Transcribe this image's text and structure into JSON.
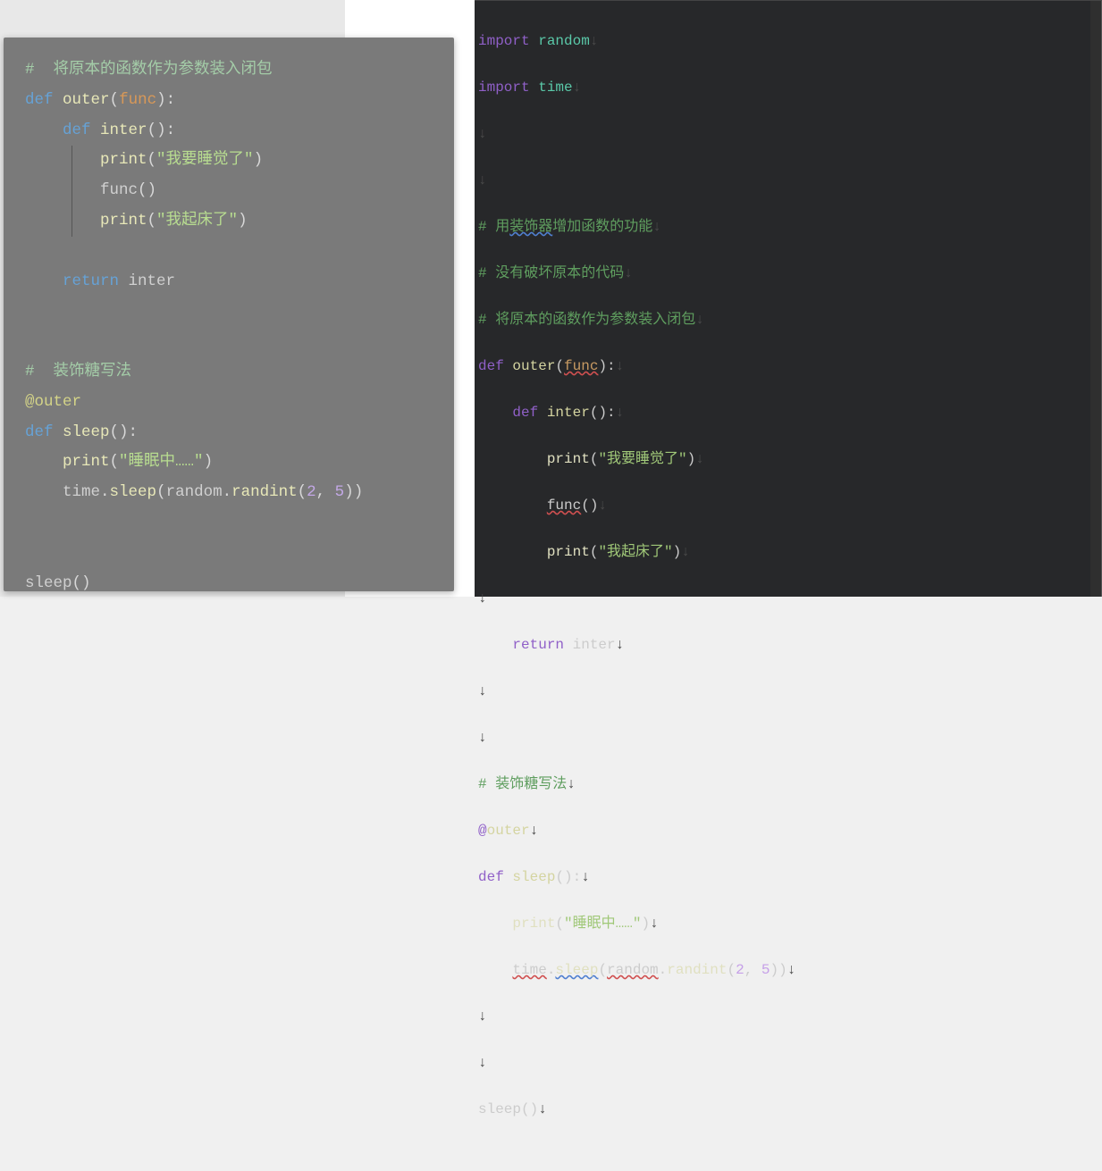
{
  "left": {
    "comment1": "#  将原本的函数作为参数装入闭包",
    "l2_def": "def",
    "l2_outer": "outer",
    "l2_func": "func",
    "l3_def": "def",
    "l3_inter": "inter",
    "l4_print": "print",
    "l4_str": "\"我要睡觉了\"",
    "l5_func": "func",
    "l6_print": "print",
    "l6_str": "\"我起床了\"",
    "l8_return": "return",
    "l8_inter": "inter",
    "comment2": "#  装饰糖写法",
    "l11_deco": "@outer",
    "l12_def": "def",
    "l12_sleep": "sleep",
    "l13_print": "print",
    "l13_str": "\"睡眠中……\"",
    "l14_time": "time",
    "l14_sleep": "sleep",
    "l14_random": "random",
    "l14_randint": "randint",
    "l14_a": "2",
    "l14_b": "5",
    "l16_sleep": "sleep"
  },
  "right": {
    "l1_import": "import",
    "l1_random": "random",
    "l2_import": "import",
    "l2_time": "time",
    "c1_a": "# 用",
    "c1_b": "装饰器",
    "c1_c": "增加函数的功能",
    "c2": "# 没有破坏原本的代码",
    "c3": "# 将原本的函数作为参数装入闭包",
    "l8_def": "def",
    "l8_outer": "outer",
    "l8_func": "func",
    "l9_def": "def",
    "l9_inter": "inter",
    "l10_print": "print",
    "l10_str": "\"我要睡觉了\"",
    "l11_func": "func",
    "l12_print": "print",
    "l12_str": "\"我起床了\"",
    "l14_return": "return",
    "l14_inter": "inter",
    "c4": "# 装饰糖写法",
    "l17_at": "@",
    "l17_outer": "outer",
    "l18_def": "def",
    "l18_sleep": "sleep",
    "l19_print": "print",
    "l19_str": "\"睡眠中……\"",
    "l20_time": "time",
    "l20_sleep": "sleep",
    "l20_random": "random",
    "l20_randint": "randint",
    "l20_a": "2",
    "l20_b": "5",
    "l23_sleep": "sleep",
    "eol": "↓"
  }
}
